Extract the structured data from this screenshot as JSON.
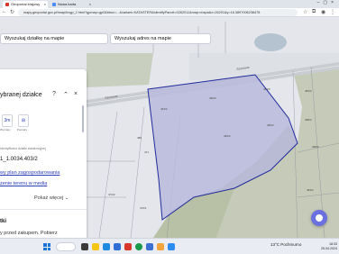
{
  "browser": {
    "tabs": [
      {
        "title": "Geoportal krajowy",
        "active": true
      },
      {
        "title": "Nowa karta",
        "active": false
      }
    ],
    "url": "mapy.geoportal.gov.pl/imap/Imgp_2.html?gpmap=gp0&bbox=...&variant=KATASTER&identifyParcel=0262011&map=mapa&x=26201&y=16.3897006238478"
  },
  "map": {
    "search_parcel_label": "Wyszukaj działkę na mapie",
    "search_address_label": "Wyszukaj adres na mapie",
    "road_label": "Szosowa",
    "parcel_labels": [
      {
        "text": "466/3"
      },
      {
        "text": "464/3"
      },
      {
        "text": "465/2"
      },
      {
        "text": "469/2"
      },
      {
        "text": "468/2"
      },
      {
        "text": "468/3"
      },
      {
        "text": "483/2"
      },
      {
        "text": "484/2"
      },
      {
        "text": "480"
      },
      {
        "text": "471"
      },
      {
        "text": "472/2"
      },
      {
        "text": "476/1"
      },
      {
        "text": "464/2"
      }
    ],
    "colors": {
      "selection_fill": "#b9bbdd",
      "selection_stroke": "#1f2a9a",
      "forest": "#bfc7b0",
      "road": "#c8cbd0"
    }
  },
  "panel": {
    "title": "ybranej działce",
    "card1": "3m",
    "card1_label": "Wymiary",
    "card2_label": "Pomiary",
    "small_label": "Identyfikator działki ewidencyjnej",
    "parcel_id": "1_1.0034.403/2",
    "link1": "wy plan zagospodarowania",
    "link2": "zenie terenu w media",
    "more_label": "Pokaż więcej",
    "section_label": "tki",
    "section_text": "y przed zakupem. Pobierz"
  },
  "taskbar": {
    "weather": "13°C  Pochmurno",
    "time": "18:33",
    "date": "25.04.2024"
  }
}
